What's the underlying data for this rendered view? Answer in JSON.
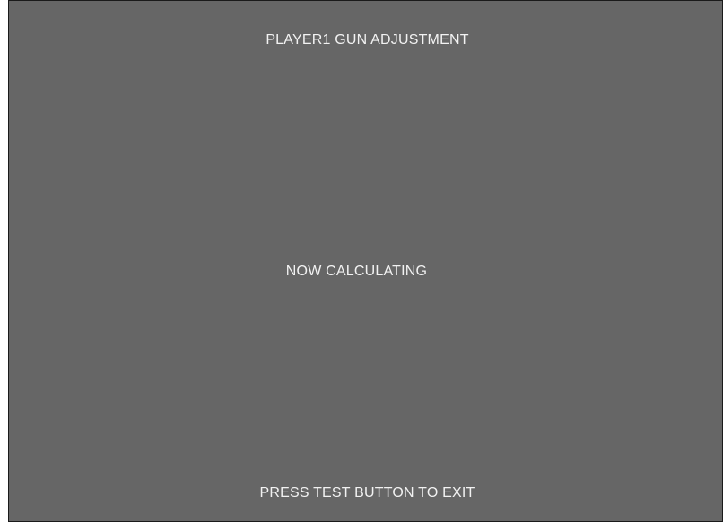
{
  "screen": {
    "title": "PLAYER1 GUN ADJUSTMENT",
    "status": "NOW CALCULATING",
    "footer_instruction": "PRESS TEST BUTTON TO EXIT",
    "colors": {
      "background": "#666666",
      "text": "#f2f2f2",
      "border": "#1a1a1a"
    }
  }
}
